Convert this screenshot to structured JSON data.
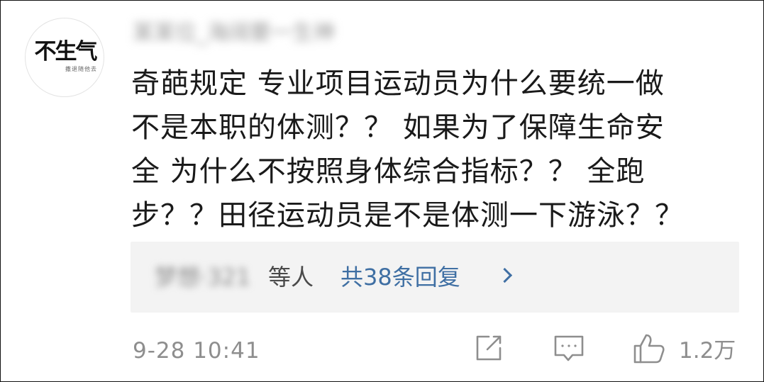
{
  "user": {
    "avatar_text": "不生气",
    "avatar_subtext": "撒退随他去",
    "username": "某某位_海阔要一生神"
  },
  "comment": {
    "text": "奇葩规定 专业项目运动员为什么要统一做\n不是本职的体测？？ 如果为了保障生命安\n全 为什么不按照身体综合指标？？ 全跑\n步？？田径运动员是不是体测一下游泳？？"
  },
  "replies": {
    "user": "梦想·321",
    "suffix": "等人",
    "count_label": "共38条回复"
  },
  "footer": {
    "timestamp": "9-28 10:41",
    "like_count": "1.2万",
    "icons": [
      "share-icon",
      "comment-icon",
      "like-icon"
    ]
  },
  "colors": {
    "link": "#3f6fa3",
    "muted": "#8e8e8e",
    "reply_bg": "#f3f3f3"
  }
}
